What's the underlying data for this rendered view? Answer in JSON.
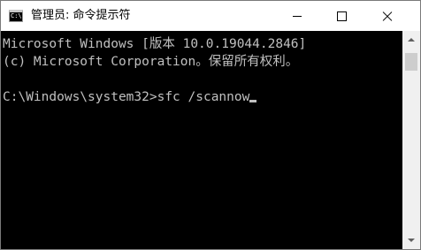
{
  "window": {
    "title": "管理员: 命令提示符",
    "icon": "console-app-icon",
    "icon_text": "C:\\."
  },
  "console": {
    "lines": [
      "Microsoft Windows [版本 10.0.19044.2846]",
      "(c) Microsoft Corporation。保留所有权利。",
      "",
      "C:\\Windows\\system32>sfc /scannow"
    ]
  },
  "colors": {
    "console_background": "#000000",
    "console_text": "#c0c0c0",
    "titlebar_background": "#ffffff",
    "scrollbar_track": "#f0f0f0",
    "scrollbar_thumb": "#cdcdcd"
  }
}
